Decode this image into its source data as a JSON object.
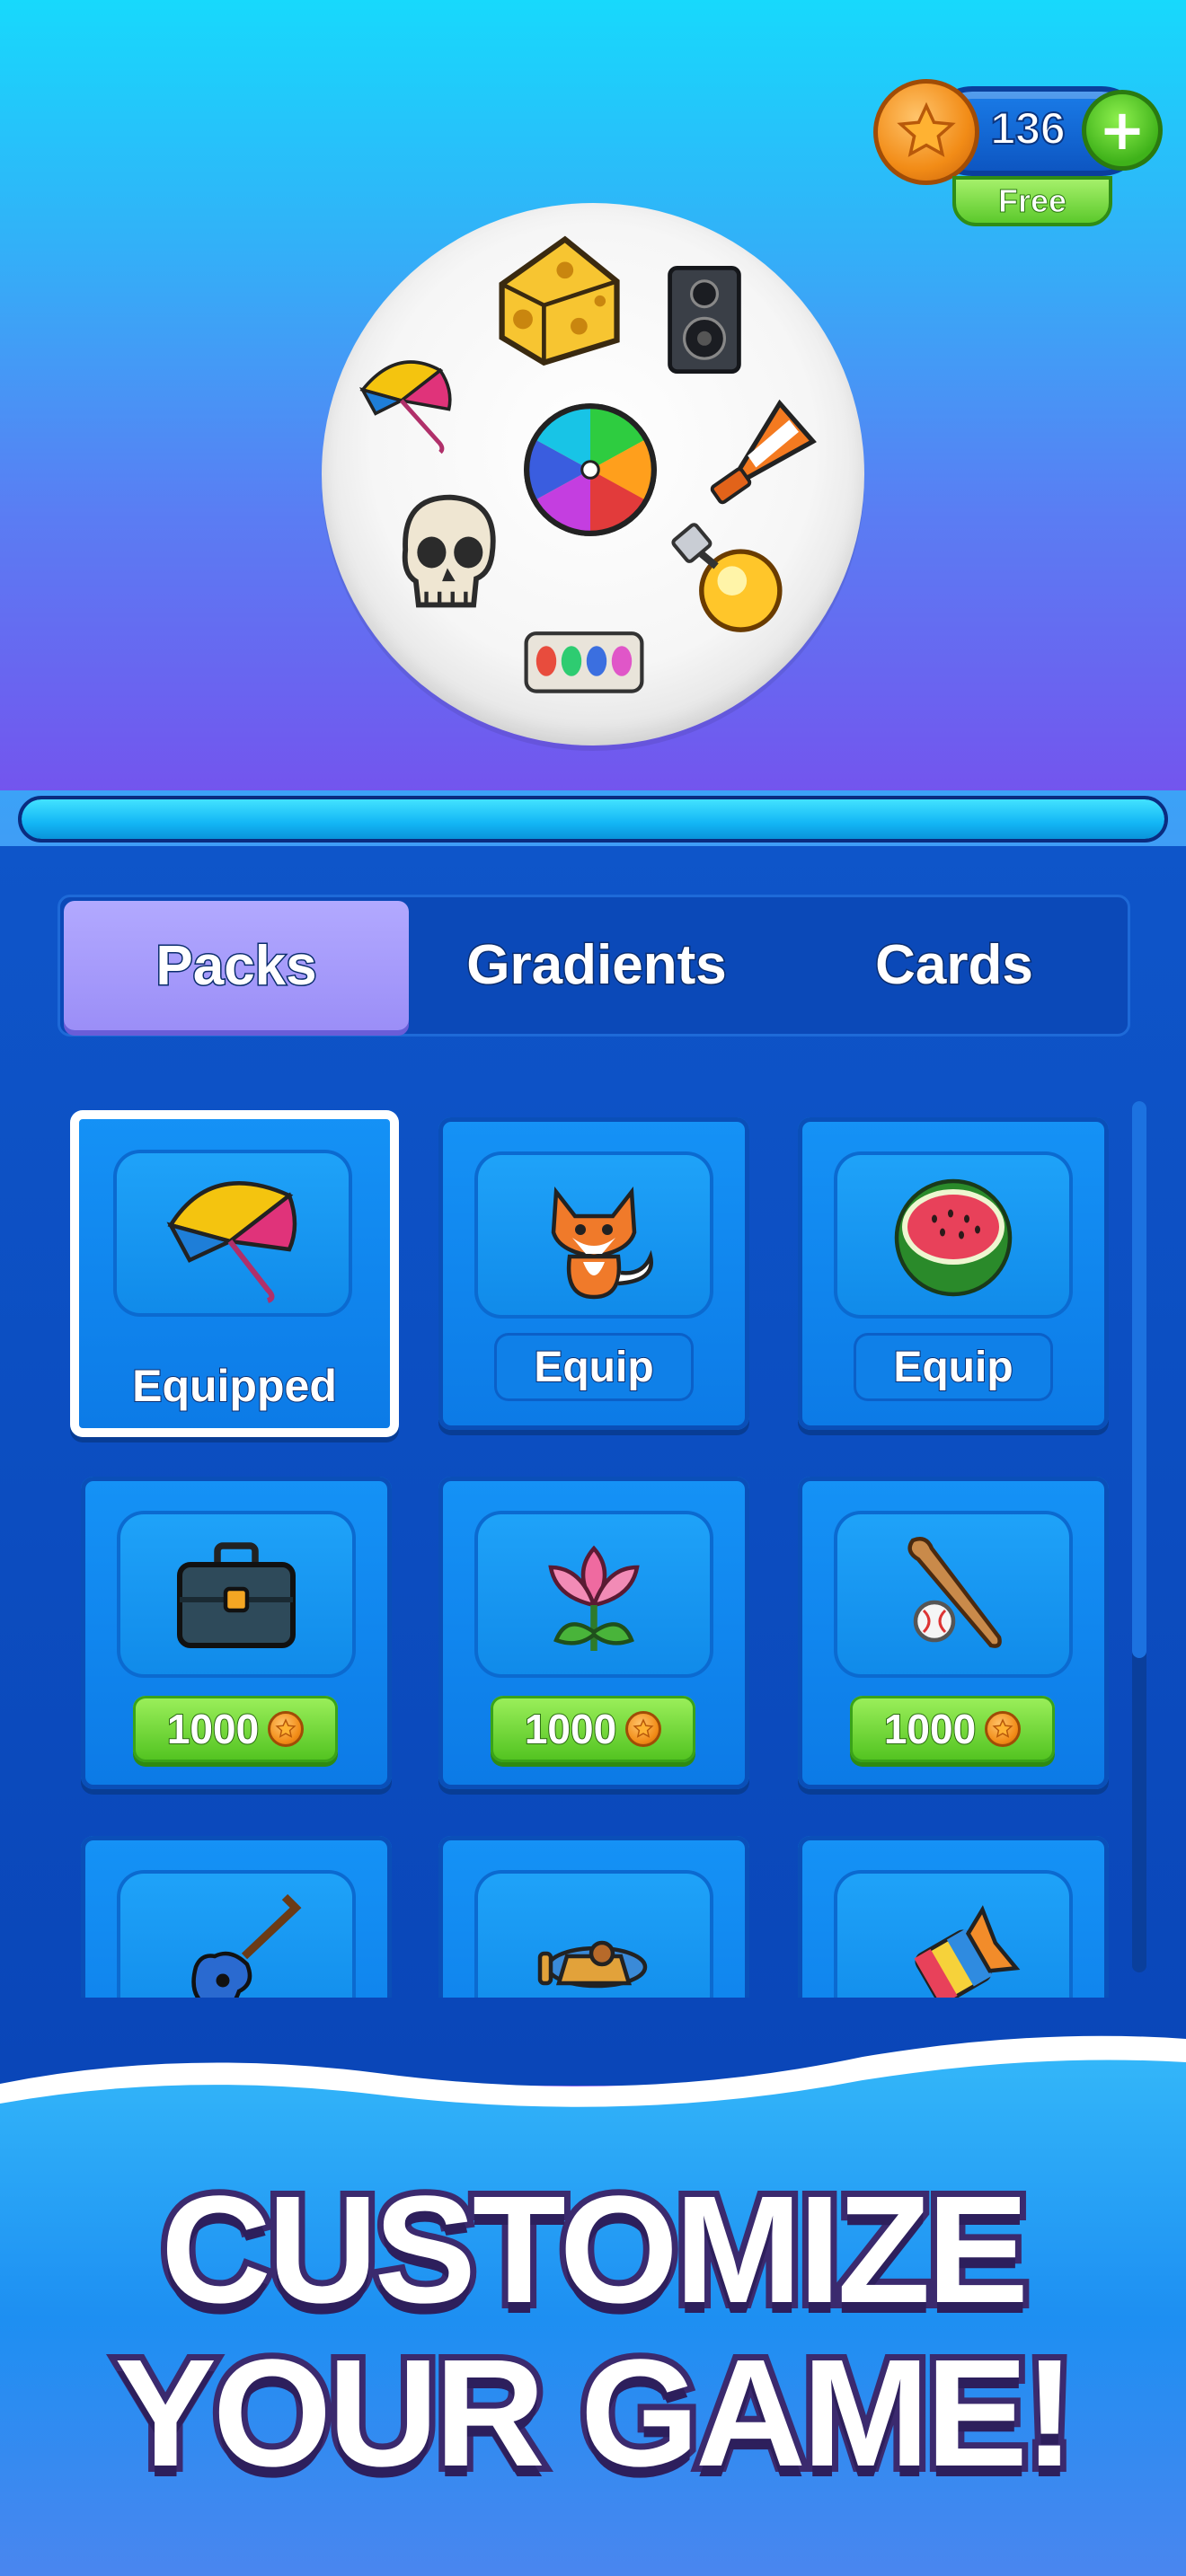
{
  "currency": {
    "amount": "136",
    "plus_label": "+",
    "free_label": "Free"
  },
  "plate": {
    "items": [
      "cheese-icon",
      "speaker-icon",
      "umbrella-icon",
      "beach-ball-icon",
      "traffic-cone-icon",
      "skull-icon",
      "light-bulb-icon",
      "egg-carton-icon"
    ]
  },
  "progress": {
    "fraction": 1.0
  },
  "tabs": [
    {
      "label": "Packs",
      "active": true
    },
    {
      "label": "Gradients",
      "active": false
    },
    {
      "label": "Cards",
      "active": false
    }
  ],
  "packs": [
    {
      "icon": "umbrella-icon",
      "state": "equipped",
      "label": "Equipped"
    },
    {
      "icon": "fox-icon",
      "state": "owned",
      "label": "Equip"
    },
    {
      "icon": "watermelon-icon",
      "state": "owned",
      "label": "Equip"
    },
    {
      "icon": "briefcase-icon",
      "state": "locked",
      "price": "1000"
    },
    {
      "icon": "lotus-icon",
      "state": "locked",
      "price": "1000"
    },
    {
      "icon": "baseball-bat-icon",
      "state": "locked",
      "price": "1000"
    },
    {
      "icon": "guitar-icon",
      "state": "locked"
    },
    {
      "icon": "airplane-icon",
      "state": "locked"
    },
    {
      "icon": "candy-icon",
      "state": "locked"
    }
  ],
  "banner": {
    "line1": "CUSTOMIZE",
    "line2": "YOUR GAME!"
  },
  "colors": {
    "accent_blue": "#0e55c9",
    "active_tab": "#9b8ef7",
    "price_green": "#50c21f",
    "coin_orange": "#f28c17"
  }
}
